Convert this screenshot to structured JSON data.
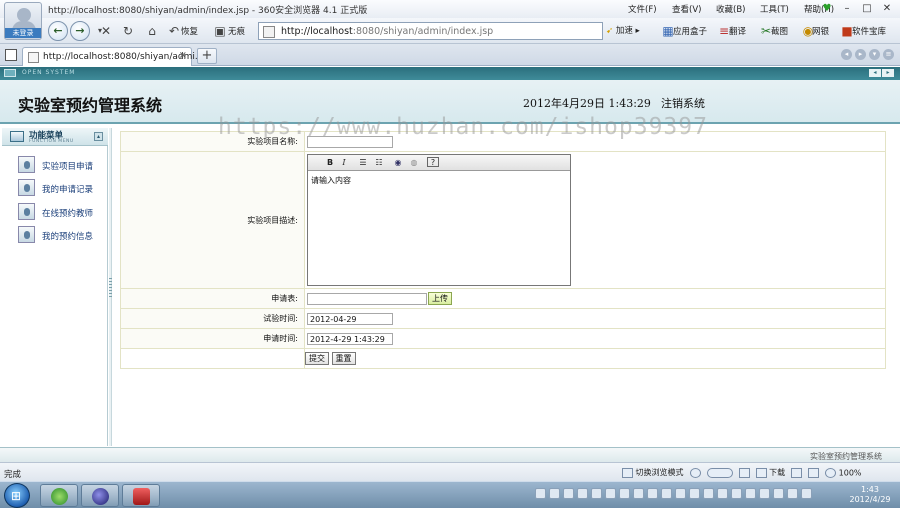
{
  "browser": {
    "title": "http://localhost:8080/shiyan/admin/index.jsp - 360安全浏览器 4.1 正式版",
    "avatar_label": "未登录",
    "menus": [
      "文件(F)",
      "查看(V)",
      "收藏(B)",
      "工具(T)",
      "帮助(H)"
    ],
    "toolbar": {
      "restore_label": "恢复",
      "noimage_label": "无痕",
      "address_host": "http://localhost",
      "address_rest": ":8080/shiyan/admin/index.jsp",
      "speedup_label": "加速",
      "right_items": [
        "应用盒子",
        "翻译",
        "截图",
        "网银",
        "软件宝库"
      ]
    },
    "tab": {
      "title": "http://localhost:8080/shiyan/admi..."
    },
    "status": {
      "left": "完成",
      "mode": "切换浏览模式",
      "download": "下载",
      "zoom": "100%"
    }
  },
  "app": {
    "strip_text": "OPEN SYSTEM",
    "title": "实验室预约管理系统",
    "datetime": "2012年4月29日  1:43:29",
    "logout": "注销系统",
    "watermark": "https://www.huzhan.com/ishop39397",
    "sidebar": {
      "title": "功能菜单",
      "subtitle": "FUNCTION MENU",
      "items": [
        "实验项目申请",
        "我的申请记录",
        "在线预约教师",
        "我的预约信息"
      ]
    },
    "form": {
      "name_label": "实验项目名称:",
      "name_value": "",
      "desc_label": "实验项目描述:",
      "desc_value": "请输入内容",
      "applicant_label": "申请表:",
      "upload_label": "上传",
      "exp_time_label": "试验时间:",
      "exp_time_value": "2012-04-29",
      "apply_time_label": "申请时间:",
      "apply_time_value": "2012-4-29 1:43:29",
      "submit_label": "提交",
      "reset_label": "重置"
    },
    "footer": "实验室预约管理系统"
  },
  "taskbar": {
    "time": "1:43",
    "date": "2012/4/29"
  }
}
